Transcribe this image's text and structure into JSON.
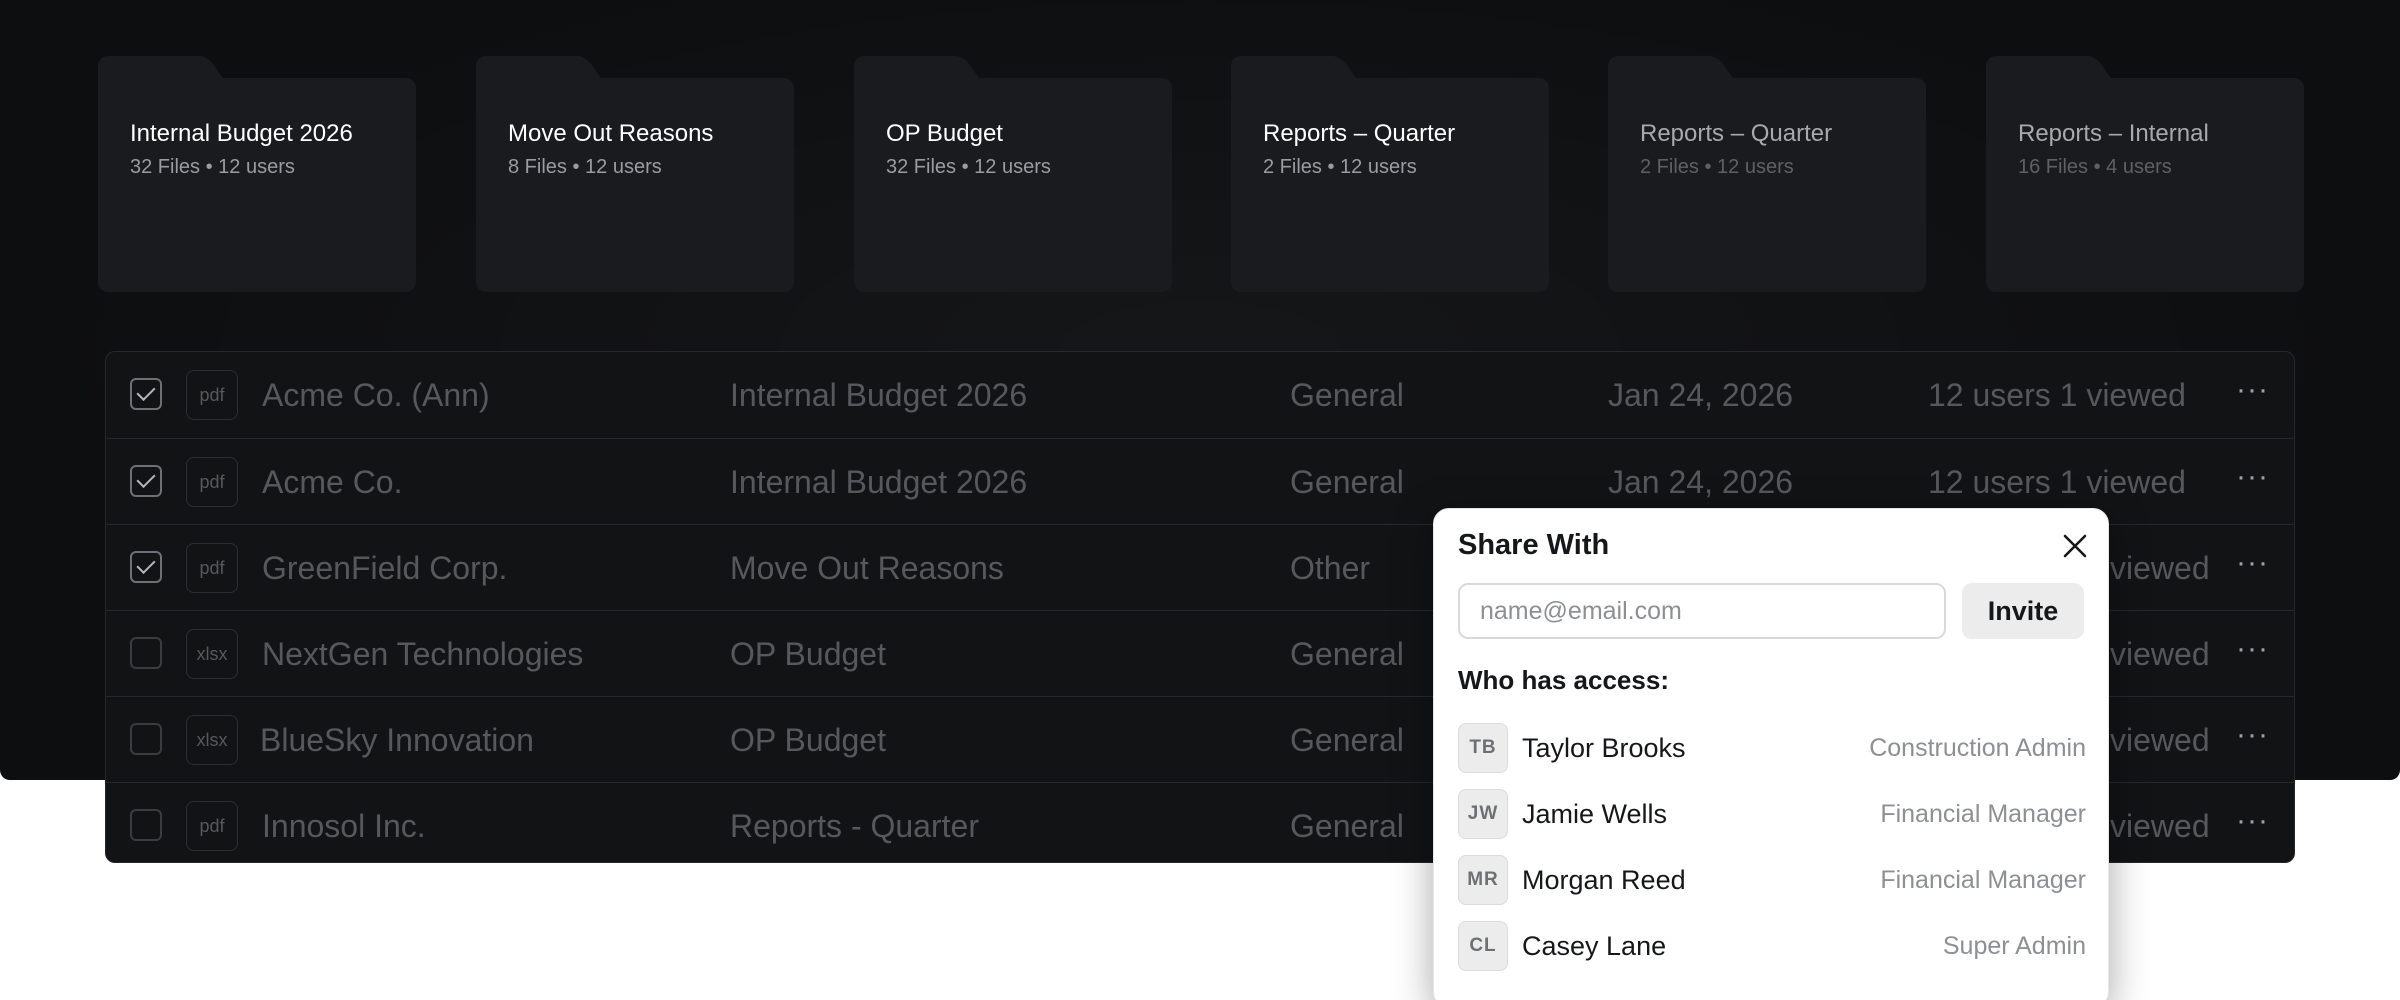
{
  "folders": [
    {
      "title": "Internal Budget 2026",
      "meta": "32 Files • 12 users"
    },
    {
      "title": "Move Out Reasons",
      "meta": "8 Files • 12 users"
    },
    {
      "title": "OP Budget",
      "meta": "32 Files • 12 users"
    },
    {
      "title": "Reports – Quarter",
      "meta": "2 Files • 12 users"
    },
    {
      "title": "Reports – Quarter",
      "meta": "2 Files • 12 users"
    },
    {
      "title": "Reports  – Internal",
      "meta": "16 Files • 4 users"
    }
  ],
  "files": [
    {
      "checked": true,
      "type": "pdf",
      "name": "Acme Co. (Ann)",
      "folder": "Internal Budget 2026",
      "category": "General",
      "date": "Jan 24, 2026",
      "access": "12 users 1 viewed"
    },
    {
      "checked": true,
      "type": "pdf",
      "name": "Acme Co.",
      "folder": "Internal Budget 2026",
      "category": "General",
      "date": "Jan 24, 2026",
      "access": "12 users 1 viewed"
    },
    {
      "checked": true,
      "type": "pdf",
      "name": "GreenField Corp.",
      "folder": "Move Out Reasons",
      "category": "Other",
      "date": "",
      "access": "viewed"
    },
    {
      "checked": false,
      "type": "xlsx",
      "name": "NextGen Technologies",
      "folder": "OP Budget",
      "category": "General",
      "date": "",
      "access": "viewed"
    },
    {
      "checked": false,
      "type": "xlsx",
      "name": "BlueSky Innovation",
      "folder": "OP Budget",
      "category": "General",
      "date": "",
      "access": "viewed"
    },
    {
      "checked": false,
      "type": "pdf",
      "name": "Innosol Inc.",
      "folder": "Reports - Quarter",
      "category": "General",
      "date": "",
      "access": "viewed"
    }
  ],
  "more_label": "···",
  "share": {
    "title": "Share With",
    "email_placeholder": "name@email.com",
    "invite_label": "Invite",
    "access_label": "Who has access:",
    "people": [
      {
        "initials": "TB",
        "name": "Taylor Brooks",
        "role": "Construction Admin"
      },
      {
        "initials": "JW",
        "name": "Jamie Wells",
        "role": "Financial Manager"
      },
      {
        "initials": "MR",
        "name": "Morgan Reed",
        "role": "Financial Manager"
      },
      {
        "initials": "CL",
        "name": "Casey Lane",
        "role": "Super Admin"
      }
    ]
  }
}
